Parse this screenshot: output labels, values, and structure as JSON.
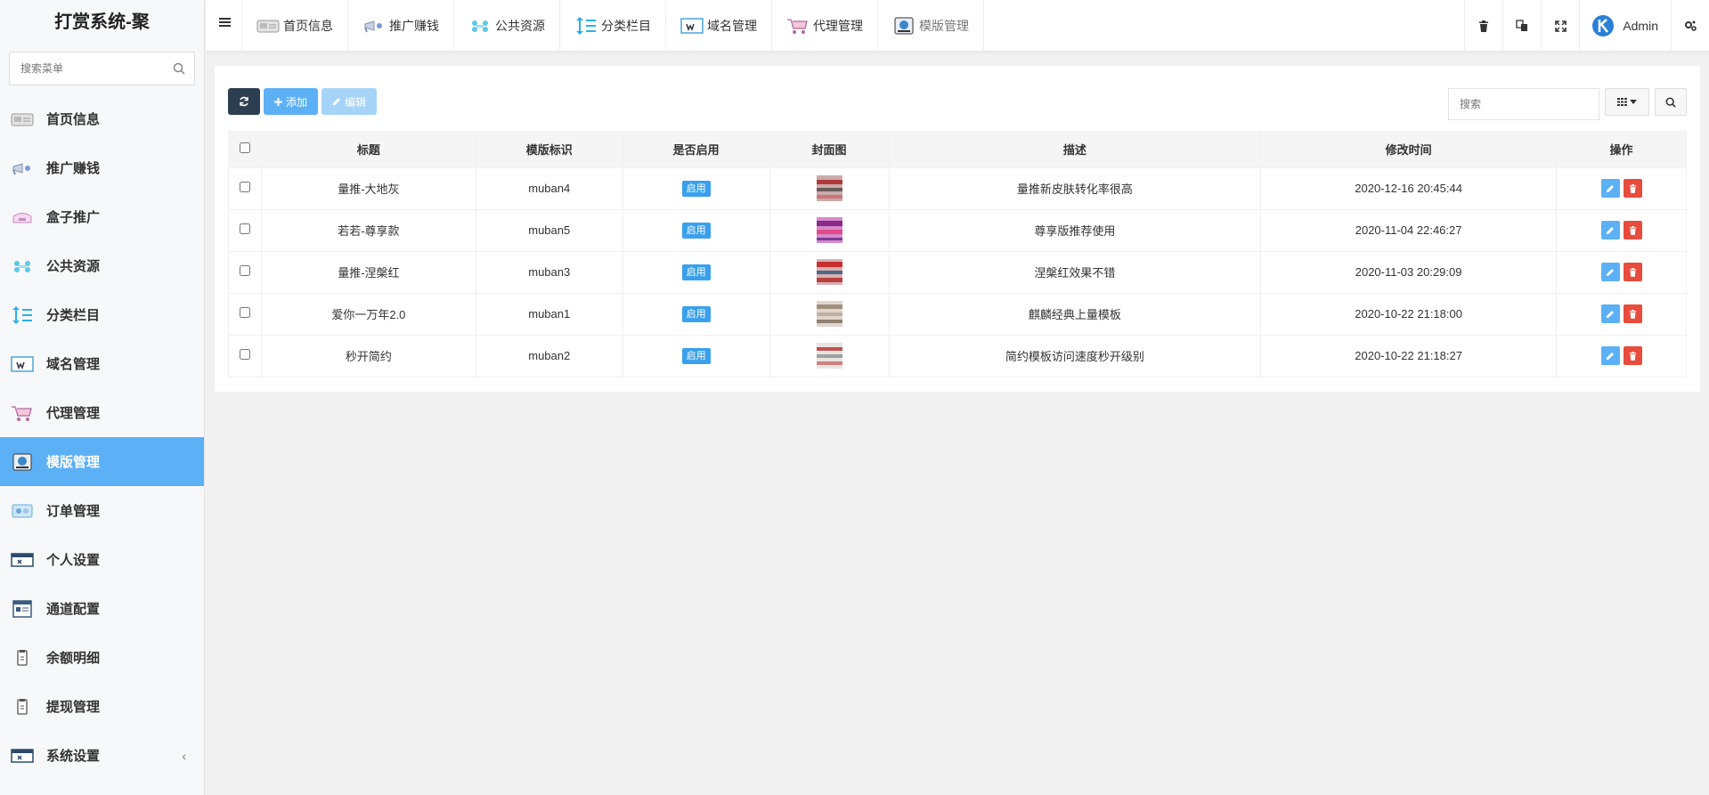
{
  "app": {
    "title": "打赏系统-聚"
  },
  "sidebar": {
    "search_placeholder": "搜索菜单",
    "items": [
      {
        "label": "首页信息",
        "icon": "home-info-icon"
      },
      {
        "label": "推广赚钱",
        "icon": "promo-icon"
      },
      {
        "label": "盒子推广",
        "icon": "box-icon"
      },
      {
        "label": "公共资源",
        "icon": "resource-icon"
      },
      {
        "label": "分类栏目",
        "icon": "category-icon"
      },
      {
        "label": "域名管理",
        "icon": "domain-icon"
      },
      {
        "label": "代理管理",
        "icon": "cart-icon"
      },
      {
        "label": "模版管理",
        "icon": "template-icon",
        "active": true
      },
      {
        "label": "订单管理",
        "icon": "order-icon"
      },
      {
        "label": "个人设置",
        "icon": "profile-icon"
      },
      {
        "label": "通道配置",
        "icon": "channel-icon"
      },
      {
        "label": "余额明细",
        "icon": "balance-icon"
      },
      {
        "label": "提现管理",
        "icon": "withdraw-icon"
      },
      {
        "label": "系统设置",
        "icon": "settings-icon",
        "arrow": "‹"
      }
    ]
  },
  "topbar": {
    "tabs": [
      {
        "label": "首页信息"
      },
      {
        "label": "推广赚钱"
      },
      {
        "label": "公共资源"
      },
      {
        "label": "分类栏目"
      },
      {
        "label": "域名管理"
      },
      {
        "label": "代理管理"
      },
      {
        "label": "模版管理",
        "current": true
      }
    ],
    "user": {
      "name": "Admin"
    }
  },
  "toolbar": {
    "add_label": "添加",
    "edit_label": "编辑",
    "search_placeholder": "搜索"
  },
  "table": {
    "columns": [
      "标题",
      "模版标识",
      "是否启用",
      "封面图",
      "描述",
      "修改时间",
      "操作"
    ],
    "rows": [
      {
        "title": "量推-大地灰",
        "code": "muban4",
        "status": "启用",
        "desc": "量推新皮肤转化率很高",
        "time": "2020-12-16 20:45:44"
      },
      {
        "title": "若若-尊享款",
        "code": "muban5",
        "status": "启用",
        "desc": "尊享版推荐使用",
        "time": "2020-11-04 22:46:27"
      },
      {
        "title": "量推-涅槃红",
        "code": "muban3",
        "status": "启用",
        "desc": "涅槃红效果不错",
        "time": "2020-11-03 20:29:09"
      },
      {
        "title": "爱你一万年2.0",
        "code": "muban1",
        "status": "启用",
        "desc": "麒麟经典上量模板",
        "time": "2020-10-22 21:18:00"
      },
      {
        "title": "秒开简约",
        "code": "muban2",
        "status": "启用",
        "desc": "简约模板访问速度秒开级别",
        "time": "2020-10-22 21:18:27"
      }
    ]
  },
  "colors": {
    "accent": "#5cb0f5",
    "danger": "#e74c3c",
    "dark": "#2c3e50",
    "badge": "#3aa0ec"
  }
}
